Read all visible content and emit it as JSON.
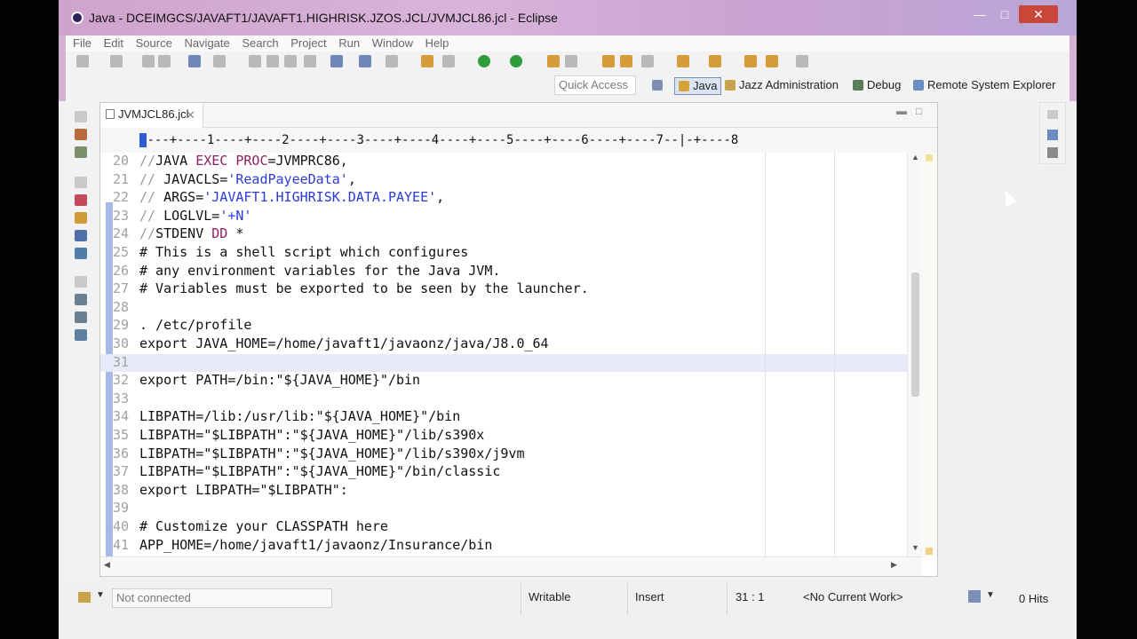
{
  "window": {
    "title": "Java - DCEIMGCS/JAVAFT1/JAVAFT1.HIGHRISK.JZOS.JCL/JVMJCL86.jcl - Eclipse"
  },
  "menu": [
    "File",
    "Edit",
    "Source",
    "Navigate",
    "Search",
    "Project",
    "Run",
    "Window",
    "Help"
  ],
  "perspectives": {
    "quick_access": "Quick Access",
    "items": [
      "Java",
      "Jazz Administration",
      "Debug",
      "Remote System Explorer"
    ]
  },
  "editor": {
    "tab_label": "JVMJCL86.jcl",
    "ruler": "----+----1----+----2----+----3----+----4----+----5----+----6----+----7--|-+----8",
    "current_line": "31",
    "lines": [
      {
        "n": "20",
        "t": "//JAVA EXEC PROC=JVMPRC86,"
      },
      {
        "n": "21",
        "t": "// JAVACLS='ReadPayeeData',"
      },
      {
        "n": "22",
        "t": "// ARGS='JAVAFT1.HIGHRISK.DATA.PAYEE',"
      },
      {
        "n": "23",
        "t": "// LOGLVL='+N'"
      },
      {
        "n": "24",
        "t": "//STDENV DD *"
      },
      {
        "n": "25",
        "t": "# This is a shell script which configures"
      },
      {
        "n": "26",
        "t": "# any environment variables for the Java JVM."
      },
      {
        "n": "27",
        "t": "# Variables must be exported to be seen by the launcher."
      },
      {
        "n": "28",
        "t": ""
      },
      {
        "n": "29",
        "t": ". /etc/profile"
      },
      {
        "n": "30",
        "t": "export JAVA_HOME=/home/javaft1/javaonz/java/J8.0_64"
      },
      {
        "n": "31",
        "t": ""
      },
      {
        "n": "32",
        "t": "export PATH=/bin:\"${JAVA_HOME}\"/bin"
      },
      {
        "n": "33",
        "t": ""
      },
      {
        "n": "34",
        "t": "LIBPATH=/lib:/usr/lib:\"${JAVA_HOME}\"/bin"
      },
      {
        "n": "35",
        "t": "LIBPATH=\"$LIBPATH\":\"${JAVA_HOME}\"/lib/s390x"
      },
      {
        "n": "36",
        "t": "LIBPATH=\"$LIBPATH\":\"${JAVA_HOME}\"/lib/s390x/j9vm"
      },
      {
        "n": "37",
        "t": "LIBPATH=\"$LIBPATH\":\"${JAVA_HOME}\"/bin/classic"
      },
      {
        "n": "38",
        "t": "export LIBPATH=\"$LIBPATH\":"
      },
      {
        "n": "39",
        "t": ""
      },
      {
        "n": "40",
        "t": "# Customize your CLASSPATH here"
      },
      {
        "n": "41",
        "t": "APP_HOME=/home/javaft1/javaonz/Insurance/bin"
      }
    ]
  },
  "status": {
    "connection": "Not connected",
    "mode": "Writable",
    "insert": "Insert",
    "position": "31 : 1",
    "work": "<No Current Work>",
    "hits": "0 Hits"
  },
  "colors": {
    "title_gradient": "#d9b4da",
    "comment": "#9b9b9b",
    "keyword": "#8e1e62",
    "string": "#2c3bd6",
    "current_line": "#e8eaf9",
    "gutter": "#a7b9e8"
  }
}
